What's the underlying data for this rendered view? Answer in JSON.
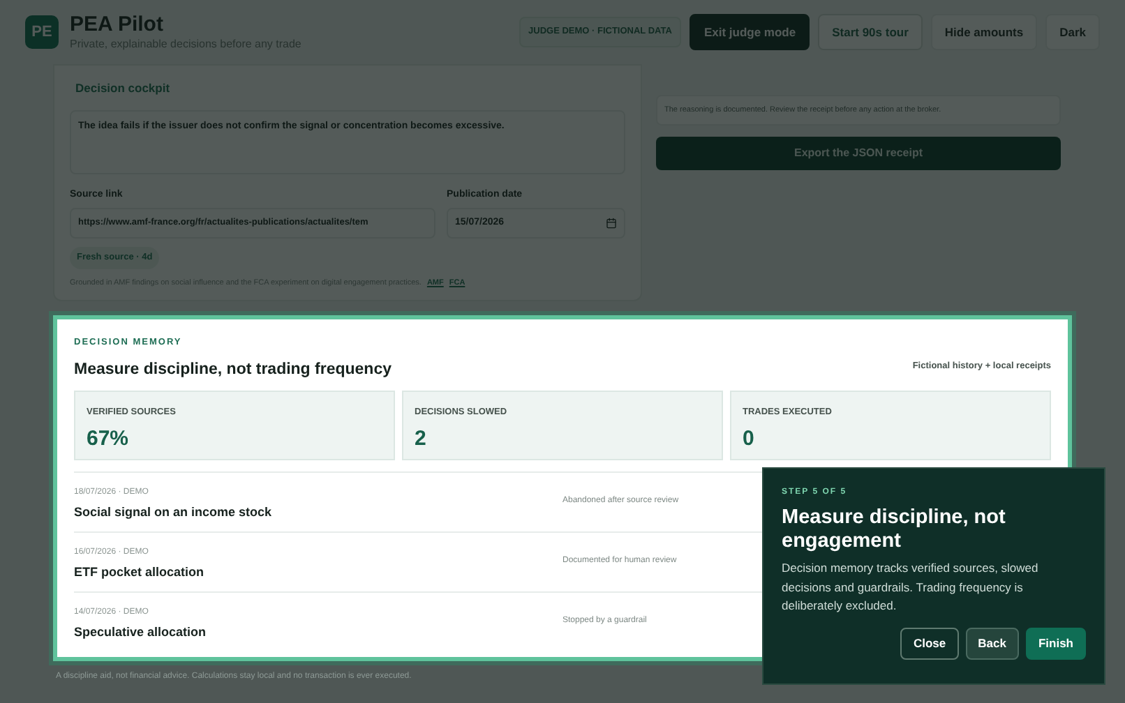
{
  "header": {
    "logo": "PE",
    "title": "PEA Pilot",
    "subtitle": "Private, explainable decisions before any trade",
    "badge": "JUDGE DEMO · FICTIONAL DATA",
    "buttons": [
      {
        "label": "Exit judge mode",
        "kind": "primary"
      },
      {
        "label": "Start 90s tour",
        "kind": "outline"
      },
      {
        "label": "Hide amounts",
        "kind": "plain"
      },
      {
        "label": "Dark",
        "kind": "plain"
      }
    ]
  },
  "cockpit": {
    "tab": "Decision cockpit",
    "invalidation": "The idea fails if the issuer does not confirm the signal or concentration becomes excessive.",
    "source_link": {
      "label": "Source link",
      "value": "https://www.amf-france.org/fr/actualites-publications/actualites/tem"
    },
    "publication_date": {
      "label": "Publication date",
      "value": "15/07/2026"
    },
    "freshness": "Fresh source · 4d",
    "grounding": "Grounded in AMF findings on social influence and the FCA experiment on digital engagement practices.",
    "links": [
      "AMF",
      "FCA"
    ],
    "notice": "The reasoning is documented. Review the receipt before any action at the broker.",
    "export_button": "Export the JSON receipt"
  },
  "memory": {
    "eyebrow": "DECISION MEMORY",
    "title": "Measure discipline, not trading frequency",
    "note": "Fictional history + local receipts",
    "stats": [
      {
        "label": "VERIFIED SOURCES",
        "value": "67%"
      },
      {
        "label": "DECISIONS SLOWED",
        "value": "2"
      },
      {
        "label": "TRADES EXECUTED",
        "value": "0"
      }
    ],
    "rows": [
      {
        "meta": "18/07/2026 · DEMO",
        "title": "Social signal on an income stock",
        "status": "Abandoned after source review"
      },
      {
        "meta": "16/07/2026 · DEMO",
        "title": "ETF pocket allocation",
        "status": "Documented for human review"
      },
      {
        "meta": "14/07/2026 · DEMO",
        "title": "Speculative allocation",
        "status": "Stopped by a guardrail"
      }
    ]
  },
  "footer": "A discipline aid, not financial advice. Calculations stay local and no transaction is ever executed.",
  "tour": {
    "step": "STEP 5 OF 5",
    "title": "Measure discipline, not engagement",
    "body": "Decision memory tracks verified sources, slowed decisions and guardrails. Trading frequency is deliberately excluded.",
    "buttons": [
      {
        "label": "Close",
        "kind": "outline"
      },
      {
        "label": "Back",
        "kind": "muted"
      },
      {
        "label": "Finish",
        "kind": "primary"
      }
    ]
  }
}
